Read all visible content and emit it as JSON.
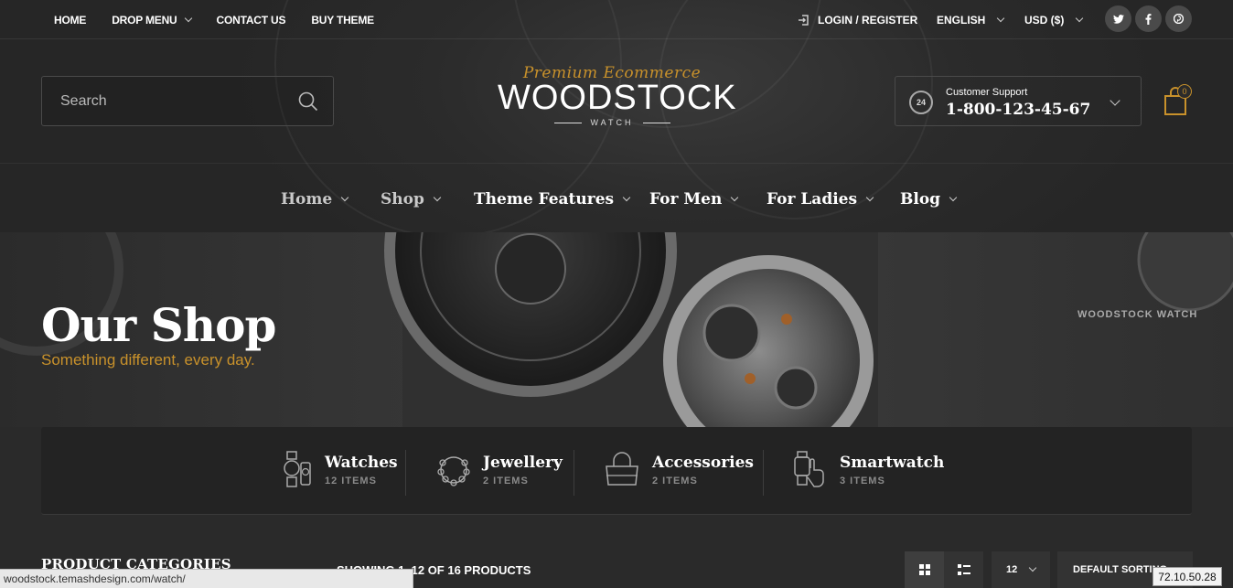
{
  "topbar": {
    "nav": [
      {
        "label": "HOME",
        "has_dropdown": false
      },
      {
        "label": "DROP MENU",
        "has_dropdown": true
      },
      {
        "label": "CONTACT US",
        "has_dropdown": false
      },
      {
        "label": "BUY THEME",
        "has_dropdown": false
      }
    ],
    "login_label": "LOGIN / REGISTER",
    "language": "ENGLISH",
    "currency": "USD ($)",
    "socials": [
      {
        "icon": "twitter-icon",
        "glyph": "t"
      },
      {
        "icon": "facebook-icon",
        "glyph": "f"
      },
      {
        "icon": "pinterest-icon",
        "glyph": "p"
      }
    ]
  },
  "search": {
    "placeholder": "Search"
  },
  "logo": {
    "tagline": "Premium Ecommerce",
    "name": "WOODSTOCK",
    "sub": "WATCH"
  },
  "support": {
    "icon_text": "24",
    "label": "Customer Support",
    "phone": "1-800-123-45-67"
  },
  "cart": {
    "count": "0"
  },
  "main_nav": [
    {
      "label": "Home"
    },
    {
      "label": "Shop"
    },
    {
      "label": "Theme Features"
    },
    {
      "label": "For Men"
    },
    {
      "label": "For Ladies"
    },
    {
      "label": "Blog"
    }
  ],
  "hero": {
    "title": "Our Shop",
    "tagline": "Something different, every day.",
    "breadcrumb": "WOODSTOCK WATCH"
  },
  "categories": [
    {
      "title": "Watches",
      "count": "12 ITEMS",
      "icon": "watch-icon"
    },
    {
      "title": "Jewellery",
      "count": "2 ITEMS",
      "icon": "necklace-icon"
    },
    {
      "title": "Accessories",
      "count": "2 ITEMS",
      "icon": "handbag-icon"
    },
    {
      "title": "Smartwatch",
      "count": "3 ITEMS",
      "icon": "smartwatch-icon"
    }
  ],
  "shop": {
    "categories_title": "PRODUCT CATEGORIES",
    "showing": "SHOWING 1–12 OF 16 PRODUCTS",
    "per_page": "12",
    "sorting": "DEFAULT SORTING"
  },
  "browser": {
    "status_url": "woodstock.temashdesign.com/watch/",
    "ip": "72.10.50.28"
  },
  "colors": {
    "accent": "#c8912b",
    "background": "#2a2a2a"
  }
}
